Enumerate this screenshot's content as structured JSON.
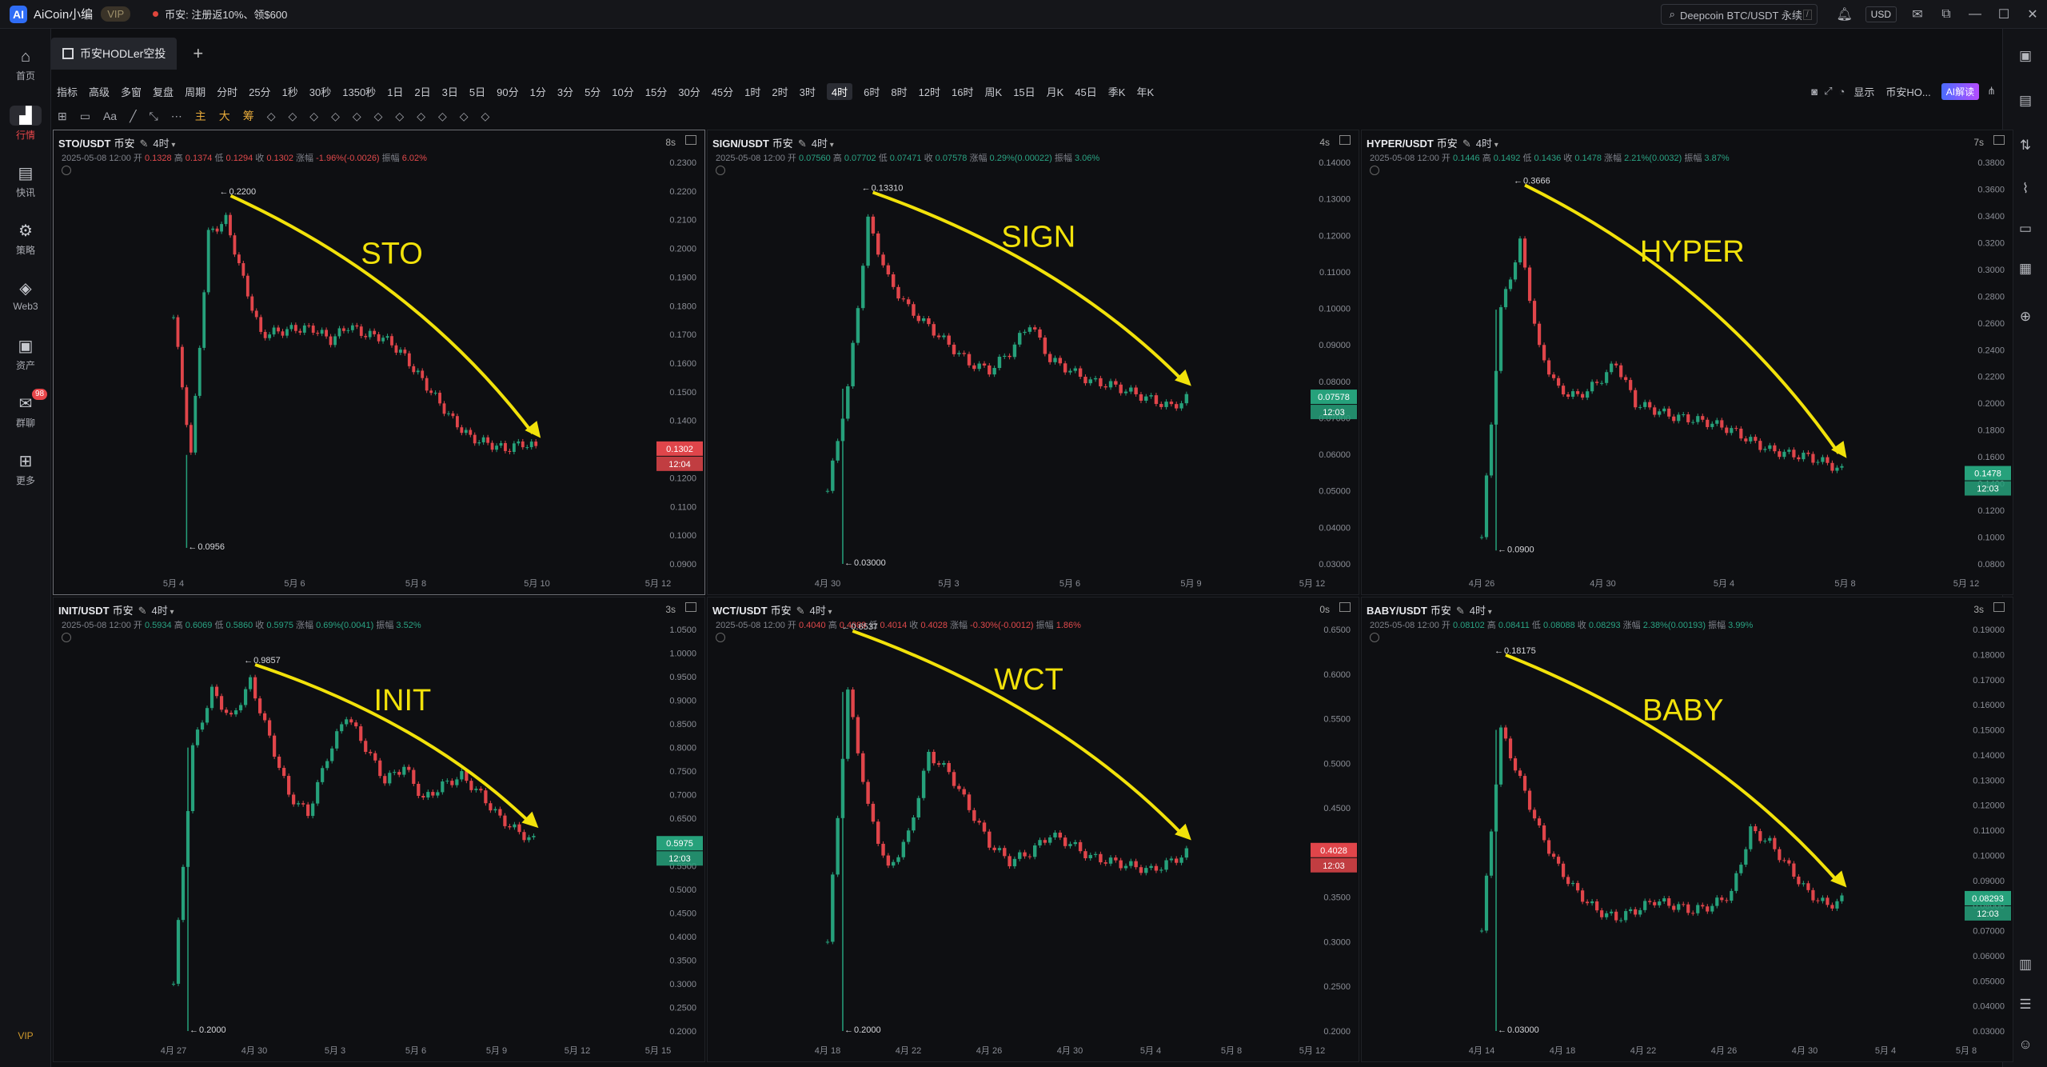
{
  "titlebar": {
    "logo_letter": "AI",
    "app_title": "AiCoin小编",
    "vip": "VIP",
    "promo": "币安: 注册返10%、领$600",
    "search": "Deepcoin BTC/USDT 永续",
    "search_key": "/",
    "currency": "USD"
  },
  "nav": [
    {
      "icon": "home-icon",
      "glyph": "⌂",
      "label": "首页"
    },
    {
      "icon": "market-icon",
      "glyph": "▟",
      "label": "行情"
    },
    {
      "icon": "news-icon",
      "glyph": "▤",
      "label": "快讯"
    },
    {
      "icon": "robot-icon",
      "glyph": "⚙",
      "label": "策略"
    },
    {
      "icon": "web3-icon",
      "glyph": "◈",
      "label": "Web3"
    },
    {
      "icon": "wallet-icon",
      "glyph": "▣",
      "label": "资产"
    },
    {
      "icon": "chat-icon",
      "glyph": "✉",
      "label": "群聊"
    },
    {
      "icon": "more-icon",
      "glyph": "⊞",
      "label": "更多"
    }
  ],
  "nav_badge": "98",
  "nav_vip": "VIP",
  "tab": {
    "label": "币安HODLer空投",
    "add": "+"
  },
  "toolbar": {
    "items": [
      "指标",
      "高级",
      "多窗",
      "复盘",
      "周期",
      "分时",
      "25分",
      "1秒",
      "30秒",
      "1350秒",
      "1日",
      "2日",
      "3日",
      "5日",
      "90分",
      "1分",
      "3分",
      "5分",
      "10分",
      "15分",
      "30分",
      "45分",
      "1时",
      "2时",
      "3时",
      "4时",
      "6时",
      "8时",
      "12时",
      "16时",
      "周K",
      "15日",
      "月K",
      "45日",
      "季K",
      "年K"
    ],
    "active": "4时",
    "right": [
      "显示",
      "币安HO...",
      "AI解读"
    ]
  },
  "drawbar": [
    "主",
    "大",
    "筹"
  ],
  "charts": [
    {
      "pair": "STO/USDT",
      "exchange": "币安",
      "interval": "4时",
      "timer": "8s",
      "date": "2025-05-08 12:00",
      "open": "0.1328",
      "high": "0.1374",
      "low": "0.1294",
      "close": "0.1302",
      "change": "-1.96%(-0.0026)",
      "amp": "6.02%",
      "label": "STO",
      "dir": "dn",
      "y_ticks": [
        "0.2300",
        "0.2200",
        "0.2100",
        "0.2000",
        "0.1900",
        "0.1800",
        "0.1700",
        "0.1600",
        "0.1500",
        "0.1400",
        "0.1300",
        "0.1200",
        "0.1100",
        "0.1000",
        "0.0900"
      ],
      "x_ticks": [
        "5月 4",
        "5月 6",
        "5月 8",
        "5月 10",
        "5月 12"
      ],
      "hi_label": "0.2200",
      "lo_label": "0.0956",
      "price_tag": "0.1302",
      "time_tag": "12:04",
      "series": [
        0.176,
        0.128,
        0.205,
        0.21,
        0.189,
        0.17,
        0.171,
        0.172,
        0.172,
        0.168,
        0.173,
        0.17,
        0.169,
        0.164,
        0.156,
        0.148,
        0.14,
        0.134,
        0.132,
        0.13,
        0.132,
        0.1302
      ]
    },
    {
      "pair": "SIGN/USDT",
      "exchange": "币安",
      "interval": "4时",
      "timer": "4s",
      "date": "2025-05-08 12:00",
      "open": "0.07560",
      "high": "0.07702",
      "low": "0.07471",
      "close": "0.07578",
      "change": "0.29%(0.00022)",
      "amp": "3.06%",
      "label": "SIGN",
      "dir": "up",
      "y_ticks": [
        "0.14000",
        "0.13000",
        "0.12000",
        "0.11000",
        "0.10000",
        "0.09000",
        "0.08000",
        "0.07000",
        "0.06000",
        "0.05000",
        "0.04000",
        "0.03000"
      ],
      "x_ticks": [
        "4月 30",
        "5月 3",
        "5月 6",
        "5月 9",
        "5月 12"
      ],
      "hi_label": "0.13310",
      "lo_label": "0.03000",
      "price_tag": "0.07578",
      "time_tag": "12:03",
      "series": [
        0.05,
        0.078,
        0.124,
        0.108,
        0.1,
        0.095,
        0.09,
        0.085,
        0.083,
        0.088,
        0.096,
        0.086,
        0.083,
        0.08,
        0.079,
        0.077,
        0.075,
        0.073,
        0.076
      ]
    },
    {
      "pair": "HYPER/USDT",
      "exchange": "币安",
      "interval": "4时",
      "timer": "7s",
      "date": "2025-05-08 12:00",
      "open": "0.1446",
      "high": "0.1492",
      "low": "0.1436",
      "close": "0.1478",
      "change": "2.21%(0.0032)",
      "amp": "3.87%",
      "label": "HYPER",
      "dir": "up",
      "y_ticks": [
        "0.3800",
        "0.3600",
        "0.3400",
        "0.3200",
        "0.3000",
        "0.2800",
        "0.2600",
        "0.2400",
        "0.2200",
        "0.2000",
        "0.1800",
        "0.1600",
        "0.1400",
        "0.1200",
        "0.1000",
        "0.0800"
      ],
      "x_ticks": [
        "4月 26",
        "4月 30",
        "5月 4",
        "5月 8",
        "5月 12"
      ],
      "hi_label": "0.3666",
      "lo_label": "0.0900",
      "price_tag": "0.1478",
      "time_tag": "12:03",
      "series": [
        0.1,
        0.27,
        0.32,
        0.24,
        0.21,
        0.205,
        0.215,
        0.23,
        0.2,
        0.195,
        0.19,
        0.188,
        0.185,
        0.18,
        0.172,
        0.165,
        0.162,
        0.16,
        0.155,
        0.1478
      ]
    },
    {
      "pair": "INIT/USDT",
      "exchange": "币安",
      "interval": "4时",
      "timer": "3s",
      "date": "2025-05-08 12:00",
      "open": "0.5934",
      "high": "0.6069",
      "low": "0.5860",
      "close": "0.5975",
      "change": "0.69%(0.0041)",
      "amp": "3.52%",
      "label": "INIT",
      "dir": "up",
      "y_ticks": [
        "1.0500",
        "1.0000",
        "0.9500",
        "0.9000",
        "0.8500",
        "0.8000",
        "0.7500",
        "0.7000",
        "0.6500",
        "0.6000",
        "0.5500",
        "0.5000",
        "0.4500",
        "0.4000",
        "0.3500",
        "0.3000",
        "0.2500",
        "0.2000"
      ],
      "x_ticks": [
        "4月 27",
        "4月 30",
        "5月 3",
        "5月 6",
        "5月 9",
        "5月 12",
        "5月 15"
      ],
      "hi_label": "0.9857",
      "lo_label": "0.2000",
      "price_tag": "0.5975",
      "time_tag": "12:03",
      "series": [
        0.3,
        0.8,
        0.92,
        0.86,
        0.94,
        0.82,
        0.7,
        0.66,
        0.78,
        0.87,
        0.8,
        0.73,
        0.76,
        0.69,
        0.72,
        0.74,
        0.7,
        0.65,
        0.62,
        0.5975
      ]
    },
    {
      "pair": "WCT/USDT",
      "exchange": "币安",
      "interval": "4时",
      "timer": "0s",
      "date": "2025-05-08 12:00",
      "open": "0.4040",
      "high": "0.4089",
      "low": "0.4014",
      "close": "0.4028",
      "change": "-0.30%(-0.0012)",
      "amp": "1.86%",
      "label": "WCT",
      "dir": "dn",
      "y_ticks": [
        "0.6500",
        "0.6000",
        "0.5500",
        "0.5000",
        "0.4500",
        "0.4000",
        "0.3500",
        "0.3000",
        "0.2500",
        "0.2000"
      ],
      "x_ticks": [
        "4月 18",
        "4月 22",
        "4月 26",
        "4月 30",
        "5月 4",
        "5月 8",
        "5月 12"
      ],
      "hi_label": "0.6537",
      "lo_label": "0.2000",
      "price_tag": "0.4028",
      "time_tag": "12:03",
      "series": [
        0.3,
        0.58,
        0.45,
        0.38,
        0.42,
        0.51,
        0.49,
        0.45,
        0.41,
        0.39,
        0.4,
        0.42,
        0.41,
        0.395,
        0.39,
        0.385,
        0.38,
        0.39,
        0.4028
      ]
    },
    {
      "pair": "BABY/USDT",
      "exchange": "币安",
      "interval": "4时",
      "timer": "3s",
      "date": "2025-05-08 12:00",
      "open": "0.08102",
      "high": "0.08411",
      "low": "0.08088",
      "close": "0.08293",
      "change": "2.38%(0.00193)",
      "amp": "3.99%",
      "label": "BABY",
      "dir": "up",
      "y_ticks": [
        "0.19000",
        "0.18000",
        "0.17000",
        "0.16000",
        "0.15000",
        "0.14000",
        "0.13000",
        "0.12000",
        "0.11000",
        "0.10000",
        "0.09000",
        "0.08000",
        "0.07000",
        "0.06000",
        "0.05000",
        "0.04000",
        "0.03000"
      ],
      "x_ticks": [
        "4月 14",
        "4月 18",
        "4月 22",
        "4月 26",
        "4月 30",
        "5月 4",
        "5月 8"
      ],
      "hi_label": "0.18175",
      "lo_label": "0.03000",
      "price_tag": "0.08293",
      "time_tag": "12:03",
      "series": [
        0.07,
        0.15,
        0.13,
        0.11,
        0.095,
        0.085,
        0.078,
        0.075,
        0.078,
        0.082,
        0.08,
        0.078,
        0.08,
        0.085,
        0.11,
        0.105,
        0.095,
        0.085,
        0.08,
        0.0829
      ]
    }
  ],
  "colors": {
    "up": "#26a17b",
    "down": "#e0454a",
    "arrow": "#f2e20a",
    "bg": "#0e0f12"
  }
}
